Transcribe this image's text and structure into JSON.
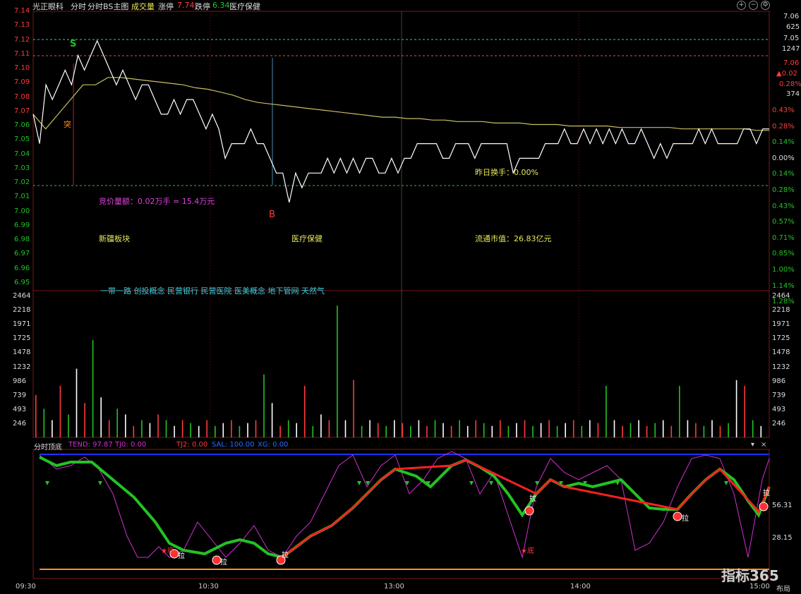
{
  "header": {
    "stock_name": "光正眼科",
    "tab_fenshi": "分时",
    "tab_bs": "分时BS主图",
    "volume_label": "成交量",
    "limit_up_label": "涨停",
    "limit_up_value": "7.74",
    "limit_down_label": "跌停",
    "limit_down_value": "6.34",
    "sector_label": "医疗保健"
  },
  "colors": {
    "up": "#ff3b3b",
    "down": "#22c322",
    "price_line": "#ffffff",
    "avg_line": "#c8c060",
    "yellow_text": "#e8e85a",
    "magenta_text": "#e040e0",
    "cyan_text": "#38d0e0",
    "blue_line": "#2030ff",
    "orange_line": "#ff9020"
  },
  "price_axis_left": [
    "7.14",
    "7.13",
    "7.12",
    "7.11",
    "7.10",
    "7.09",
    "7.08",
    "7.07",
    "7.06",
    "7.05",
    "7.04",
    "7.03",
    "7.02",
    "7.01",
    "7.00",
    "6.99",
    "6.98",
    "6.97",
    "6.96",
    "6.95"
  ],
  "pct_axis_right": [
    "0.43%",
    "0.28%",
    "0.14%",
    "0.00%",
    "0.14%",
    "0.28%",
    "0.43%",
    "0.57%",
    "0.71%",
    "0.85%",
    "1.00%",
    "1.14%",
    "1.28%"
  ],
  "right_panel": {
    "v1": "7.06",
    "v2": "625",
    "v3": "7.05",
    "v4": "1247",
    "v5": "7.06",
    "v6": "▲0.02",
    "v7": "0.28%",
    "v8": "374"
  },
  "volume_axis": [
    "2464",
    "2218",
    "1971",
    "1725",
    "1478",
    "1232",
    "986",
    "739",
    "493",
    "246"
  ],
  "annotations": {
    "mark_s": "S",
    "mark_b": "B",
    "mark_tu": "突",
    "turnover": "昨日换手：0.00%",
    "auction": "竞价量额：0.02万手 = 15.4万元",
    "board1": "新疆板块",
    "board2": "医疗保健",
    "float_cap": "流通市值：26.83亿元",
    "concepts": "一带一路 创投概念 民营银行 民营医院 医美概念 地下管网 天然气",
    "la": "拉",
    "di": "★底"
  },
  "indicator": {
    "name": "分时顶底",
    "tend": "TEND: 97.87",
    "tj0": "TJ0: 0.00",
    "tj2": "TJ2: 0.00",
    "sal": "SAL: 100.00",
    "xg": "XG: 0.00",
    "axis_hi": "56.31",
    "axis_lo": "28.15"
  },
  "time_axis": [
    "09:30",
    "10:30",
    "13:00",
    "14:00",
    "15:00"
  ],
  "layout_btn": "布局",
  "watermark": "指标365",
  "chart_data": {
    "type": "line",
    "x": [
      "09:30",
      "10:30",
      "13:00",
      "14:00",
      "15:00"
    ],
    "series": [],
    "price_ylim": [
      6.95,
      7.14
    ],
    "volume_ylim": [
      0,
      2464
    ],
    "price_values": [
      7.07,
      7.05,
      7.09,
      7.08,
      7.09,
      7.1,
      7.09,
      7.11,
      7.1,
      7.11,
      7.12,
      7.11,
      7.1,
      7.09,
      7.1,
      7.09,
      7.08,
      7.09,
      7.09,
      7.08,
      7.07,
      7.07,
      7.08,
      7.07,
      7.08,
      7.08,
      7.07,
      7.06,
      7.07,
      7.06,
      7.04,
      7.05,
      7.05,
      7.05,
      7.06,
      7.05,
      7.05,
      7.04,
      7.03,
      7.03,
      7.01,
      7.03,
      7.02,
      7.03,
      7.03,
      7.03,
      7.04,
      7.03,
      7.04,
      7.03,
      7.04,
      7.03,
      7.04,
      7.04,
      7.03,
      7.03,
      7.04,
      7.03,
      7.04,
      7.04,
      7.05,
      7.05,
      7.05,
      7.05,
      7.04,
      7.04,
      7.05,
      7.05,
      7.05,
      7.04,
      7.05,
      7.05,
      7.05,
      7.05,
      7.05,
      7.03,
      7.04,
      7.04,
      7.04,
      7.04,
      7.05,
      7.05,
      7.05,
      7.06,
      7.05,
      7.05,
      7.06,
      7.05,
      7.06,
      7.05,
      7.06,
      7.05,
      7.06,
      7.05,
      7.05,
      7.06,
      7.05,
      7.04,
      7.05,
      7.04,
      7.05,
      7.05,
      7.05,
      7.05,
      7.06,
      7.05,
      7.06,
      7.05,
      7.05,
      7.05,
      7.05,
      7.06,
      7.06,
      7.05,
      7.06,
      7.06
    ],
    "avg_values": [
      7.07,
      7.06,
      7.07,
      7.08,
      7.09,
      7.09,
      7.095,
      7.095,
      7.094,
      7.093,
      7.092,
      7.091,
      7.09,
      7.088,
      7.087,
      7.085,
      7.083,
      7.08,
      7.078,
      7.077,
      7.076,
      7.075,
      7.074,
      7.073,
      7.072,
      7.071,
      7.07,
      7.069,
      7.068,
      7.068,
      7.067,
      7.067,
      7.066,
      7.066,
      7.065,
      7.065,
      7.065,
      7.064,
      7.064,
      7.064,
      7.063,
      7.063,
      7.063,
      7.062,
      7.062,
      7.062,
      7.062,
      7.061,
      7.061,
      7.061,
      7.061,
      7.061,
      7.06,
      7.06,
      7.06,
      7.06,
      7.06,
      7.06,
      7.059,
      7.059
    ],
    "volume_values": [
      740,
      500,
      300,
      900,
      400,
      1200,
      600,
      1700,
      700,
      300,
      500,
      400,
      200,
      300,
      250,
      400,
      300,
      200,
      300,
      250,
      200,
      300,
      200,
      250,
      300,
      200,
      250,
      300,
      1100,
      600,
      200,
      300,
      250,
      900,
      200,
      400,
      300,
      2300,
      300,
      1000,
      200,
      300,
      250,
      200,
      300,
      250,
      200,
      300,
      200,
      300,
      250,
      200,
      300,
      200,
      300,
      250,
      200,
      300,
      200,
      250,
      300,
      200,
      250,
      300,
      200,
      250,
      300,
      200,
      300,
      250,
      900,
      300,
      200,
      250,
      300,
      200,
      250,
      300,
      200,
      900,
      300,
      250,
      200,
      300,
      200,
      250,
      1000,
      900,
      300,
      200
    ]
  }
}
